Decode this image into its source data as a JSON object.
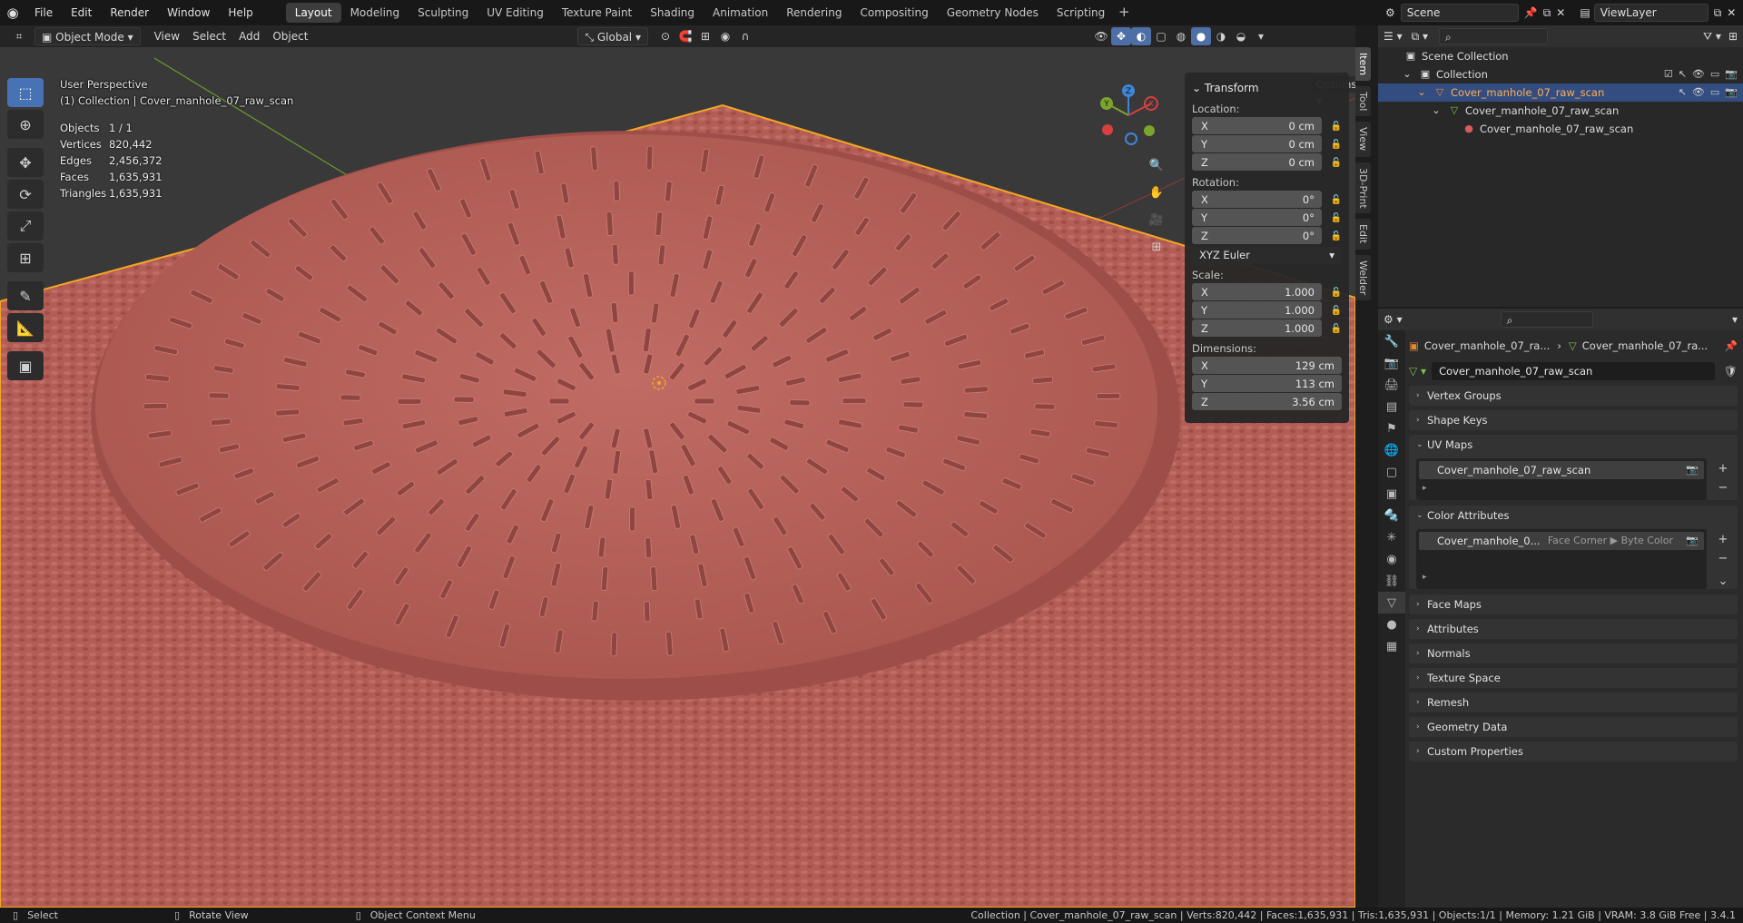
{
  "topbar": {
    "menus": [
      "File",
      "Edit",
      "Render",
      "Window",
      "Help"
    ],
    "workspaces": [
      "Layout",
      "Modeling",
      "Sculpting",
      "UV Editing",
      "Texture Paint",
      "Shading",
      "Animation",
      "Rendering",
      "Compositing",
      "Geometry Nodes",
      "Scripting"
    ],
    "active_workspace": "Layout"
  },
  "viewport": {
    "mode": "Object Mode",
    "menus": [
      "View",
      "Select",
      "Add",
      "Object"
    ],
    "orientation": "Global",
    "options_label": "Options",
    "perspective": "User Perspective",
    "collection_line": "(1) Collection | Cover_manhole_07_raw_scan",
    "stats": [
      {
        "k": "Objects",
        "v": "1 / 1"
      },
      {
        "k": "Vertices",
        "v": "820,442"
      },
      {
        "k": "Edges",
        "v": "2,456,372"
      },
      {
        "k": "Faces",
        "v": "1,635,931"
      },
      {
        "k": "Triangles",
        "v": "1,635,931"
      }
    ],
    "gizmo_axes": {
      "x": "X",
      "y": "Y",
      "z": "Z"
    },
    "colors": {
      "mesh": "#b8625c",
      "selection_outline": "#f5a623",
      "x_axis": "#d6403f",
      "y_axis": "#7aa52c",
      "z_axis": "#3f86d6"
    }
  },
  "npanel": {
    "title": "Transform",
    "location_label": "Location:",
    "location": [
      {
        "axis": "X",
        "value": "0 cm"
      },
      {
        "axis": "Y",
        "value": "0 cm"
      },
      {
        "axis": "Z",
        "value": "0 cm"
      }
    ],
    "rotation_label": "Rotation:",
    "rotation": [
      {
        "axis": "X",
        "value": "0°"
      },
      {
        "axis": "Y",
        "value": "0°"
      },
      {
        "axis": "Z",
        "value": "0°"
      }
    ],
    "rotation_mode": "XYZ Euler",
    "scale_label": "Scale:",
    "scale": [
      {
        "axis": "X",
        "value": "1.000"
      },
      {
        "axis": "Y",
        "value": "1.000"
      },
      {
        "axis": "Z",
        "value": "1.000"
      }
    ],
    "dimensions_label": "Dimensions:",
    "dimensions": [
      {
        "axis": "X",
        "value": "129 cm"
      },
      {
        "axis": "Y",
        "value": "113 cm"
      },
      {
        "axis": "Z",
        "value": "3.56 cm"
      }
    ],
    "tabs": [
      "Item",
      "Tool",
      "View",
      "3D-Print",
      "Edit",
      "Welder"
    ],
    "active_tab": "Item"
  },
  "outliner": {
    "scene": "Scene",
    "view_layer": "ViewLayer",
    "rows": [
      {
        "label": "Scene Collection",
        "indent": 0,
        "icon": "▣"
      },
      {
        "label": "Collection",
        "indent": 1,
        "icon": "▣"
      },
      {
        "label": "Cover_manhole_07_raw_scan",
        "indent": 2,
        "icon": "▽",
        "selected": true
      },
      {
        "label": "Cover_manhole_07_raw_scan",
        "indent": 3,
        "icon": "▽"
      },
      {
        "label": "Cover_manhole_07_raw_scan",
        "indent": 4,
        "icon": "●"
      }
    ]
  },
  "properties": {
    "breadcrumb_object": "Cover_manhole_07_ra...",
    "breadcrumb_data": "Cover_manhole_07_ra...",
    "mesh_name": "Cover_manhole_07_raw_scan",
    "panels": {
      "vertex_groups": "Vertex Groups",
      "shape_keys": "Shape Keys",
      "uv_maps": "UV Maps",
      "uv_map_item": "Cover_manhole_07_raw_scan",
      "color_attributes": "Color Attributes",
      "color_attr_item": "Cover_manhole_0...",
      "color_attr_domain": "Face Corner ▶ Byte Color",
      "face_maps": "Face Maps",
      "attributes": "Attributes",
      "normals": "Normals",
      "texture_space": "Texture Space",
      "remesh": "Remesh",
      "geometry_data": "Geometry Data",
      "custom_properties": "Custom Properties"
    }
  },
  "statusbar": {
    "select": "Select",
    "rotate": "Rotate View",
    "context": "Object Context Menu",
    "info": "Collection | Cover_manhole_07_raw_scan | Verts:820,442 | Faces:1,635,931 | Tris:1,635,931 | Objects:1/1 | Memory: 1.21 GiB | VRAM: 3.8 GiB Free | 3.4.1"
  }
}
